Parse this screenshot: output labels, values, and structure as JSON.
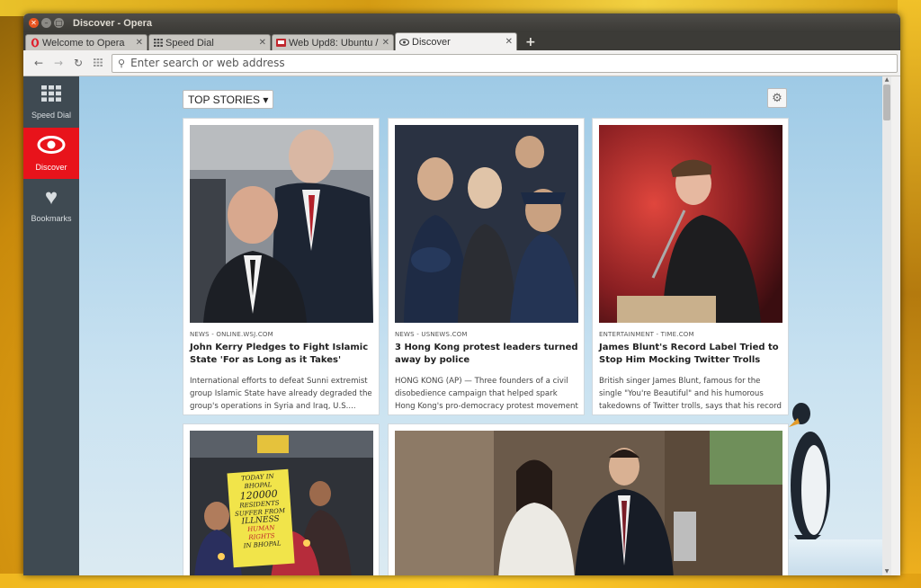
{
  "window": {
    "title": "Discover - Opera"
  },
  "tabs": [
    {
      "label": "Welcome to Opera",
      "icon": "opera-icon",
      "active": false
    },
    {
      "label": "Speed Dial",
      "icon": "grid-icon",
      "active": false
    },
    {
      "label": "Web Upd8: Ubuntu / ",
      "icon": "webupd8-icon",
      "active": false
    },
    {
      "label": "Discover",
      "icon": "eye-icon",
      "active": true
    }
  ],
  "newtab": {
    "label": "+"
  },
  "address": {
    "placeholder": "Enter search or web address"
  },
  "sidebar": {
    "items": [
      {
        "label": "Speed Dial",
        "icon": "grid-icon",
        "active": false
      },
      {
        "label": "Discover",
        "icon": "eye-icon",
        "active": true
      },
      {
        "label": "Bookmarks",
        "icon": "heart-icon",
        "active": false
      }
    ]
  },
  "discover": {
    "category": "TOP STORIES ▾",
    "cards": [
      {
        "source": "NEWS - ONLINE.WSJ.COM",
        "headline": "John Kerry Pledges to Fight Islamic State 'For as Long as it Takes'",
        "summary": "International efforts to defeat Sunni extremist group Islamic State have already degraded the group's operations in Syria and Iraq, U.S...."
      },
      {
        "source": "NEWS - USNEWS.COM",
        "headline": "3 Hong Kong protest leaders turned away by police",
        "summary": "HONG KONG (AP) — Three founders of a civil disobedience campaign that helped spark Hong Kong's pro-democracy protest movement hav..."
      },
      {
        "source": "ENTERTAINMENT - TIME.COM",
        "headline": "James Blunt's Record Label Tried to Stop Him Mocking Twitter Trolls",
        "summary": "British singer James Blunt, famous for the single \"You're Beautiful\" and his humorous takedowns of Twitter trolls, says that his record label has..."
      }
    ],
    "photo_sign": {
      "lines": [
        "TODAY IN BHOPAL",
        "120000",
        "RESIDENTS",
        "SUFFER FROM",
        "ILLNESS",
        "HUMAN RIGHTS",
        "IN BHOPAL"
      ]
    }
  }
}
